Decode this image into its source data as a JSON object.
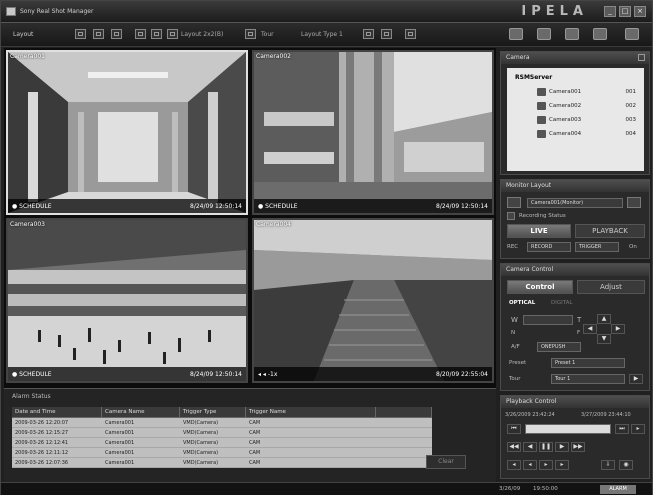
{
  "titlebar": {
    "title": "Sony Real Shot Manager",
    "brand": "IPELA",
    "btn_min": "_",
    "btn_max": "□",
    "btn_close": "×"
  },
  "toolbar": {
    "layout_label": "Layout",
    "layout_name": "Layout 2x2(B)",
    "tour_label": "Tour",
    "layout_type": "Layout Type 1"
  },
  "cameras": [
    {
      "label": "Camera001",
      "status": "● SCHEDULE",
      "time": "8/24/09 12:50:14"
    },
    {
      "label": "Camera002",
      "status": "● SCHEDULE",
      "time": "8/24/09 12:50:14"
    },
    {
      "label": "Camera003",
      "status": "● SCHEDULE",
      "time": "8/24/09 12:50:14"
    },
    {
      "label": "Camera004",
      "status": "◂ ◂ -1x",
      "time": "8/20/09 22:55:04"
    }
  ],
  "alarm": {
    "title": "Alarm Status",
    "columns": [
      "Date and Time",
      "Camera Name",
      "Trigger Type",
      "Trigger Name",
      ""
    ],
    "rows": [
      [
        "2009-03-26 12:20:07",
        "Camera001",
        "VMD(Camera)",
        "CAM",
        ""
      ],
      [
        "2009-03-26 12:15:27",
        "Camera001",
        "VMD(Camera)",
        "CAM",
        ""
      ],
      [
        "2009-03-26 12:12:41",
        "Camera001",
        "VMD(Camera)",
        "CAM",
        ""
      ],
      [
        "2009-03-26 12:11:12",
        "Camera001",
        "VMD(Camera)",
        "CAM",
        ""
      ],
      [
        "2009-03-26 12:07:36",
        "Camera001",
        "VMD(Camera)",
        "CAM",
        ""
      ]
    ],
    "clear_label": "Clear"
  },
  "statusbar": {
    "date": "3/26/09",
    "time": "19:50:00",
    "badge": "ALARM"
  },
  "camera_panel": {
    "title": "Camera",
    "root": "RSMServer",
    "items": [
      {
        "name": "Camera001",
        "value": "001"
      },
      {
        "name": "Camera002",
        "value": "002"
      },
      {
        "name": "Camera003",
        "value": "003"
      },
      {
        "name": "Camera004",
        "value": "004"
      }
    ]
  },
  "monitor_panel": {
    "title": "Monitor Layout",
    "dropdown": "Camera001(Monitor)",
    "checkbox_label": "Recording Status",
    "live_label": "LIVE",
    "playback_label": "PLAYBACK",
    "rec_label": "REC",
    "record_label": "RECORD",
    "trigger_label": "TRIGGER",
    "on_label": "On"
  },
  "control_panel": {
    "title": "Camera Control",
    "tab_control": "Control",
    "tab_adjust": "Adjust",
    "optical_label": "OPTICAL",
    "digital_label": "DIGITAL",
    "w_label": "W",
    "t_label": "T",
    "n_label": "N",
    "f_label": "F",
    "af_label": "A/F",
    "onepush_label": "ONEPUSH",
    "preset_label": "Preset",
    "preset_value": "Preset 1",
    "tour_label": "Tour",
    "tour_value": "Tour 1"
  },
  "playback_panel": {
    "title": "Playback Control",
    "start_time": "3/26/2009 23:42:24",
    "end_time": "3/27/2009 23:44:10"
  }
}
